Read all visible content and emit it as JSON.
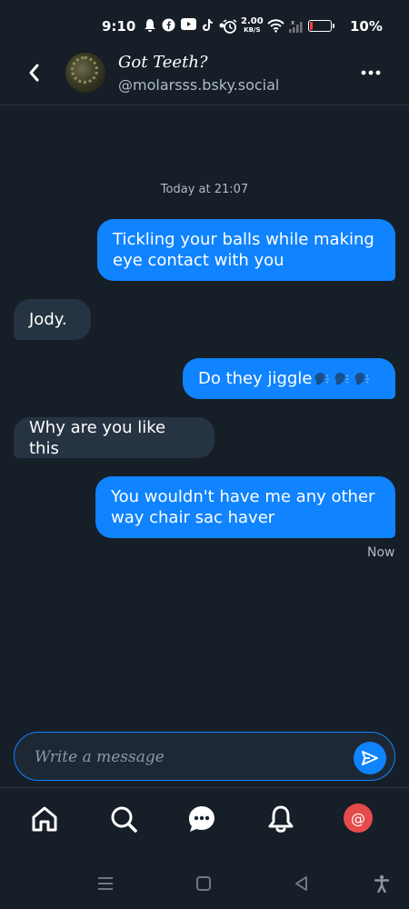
{
  "status_bar": {
    "time": "9:10",
    "network_speed": "2.00",
    "network_unit": "KB/S",
    "battery": "10%"
  },
  "header": {
    "display_name": "Got Teeth?",
    "handle": "@molarsss.bsky.social"
  },
  "conversation": {
    "date_label": "Today at 21:07",
    "messages": [
      {
        "direction": "out",
        "text": "Tickling your balls while making eye contact with you"
      },
      {
        "direction": "in",
        "text": "Jody."
      },
      {
        "direction": "out",
        "text": "Do they jiggle"
      },
      {
        "direction": "in",
        "text": "Why are you like this"
      },
      {
        "direction": "out",
        "text": "You wouldn't have me any other way chair sac haver"
      }
    ],
    "last_status": "Now"
  },
  "composer": {
    "placeholder": "Write a message"
  },
  "bottom_nav": {
    "items": [
      "home-icon",
      "search-icon",
      "chat-icon",
      "bell-icon",
      "mention-icon"
    ],
    "mention_glyph": "@"
  },
  "colors": {
    "background": "#161e27",
    "accent": "#1083fe",
    "incoming_bubble": "#263342",
    "muted_text": "#aebbc9",
    "notification_red": "#e64b4b"
  }
}
